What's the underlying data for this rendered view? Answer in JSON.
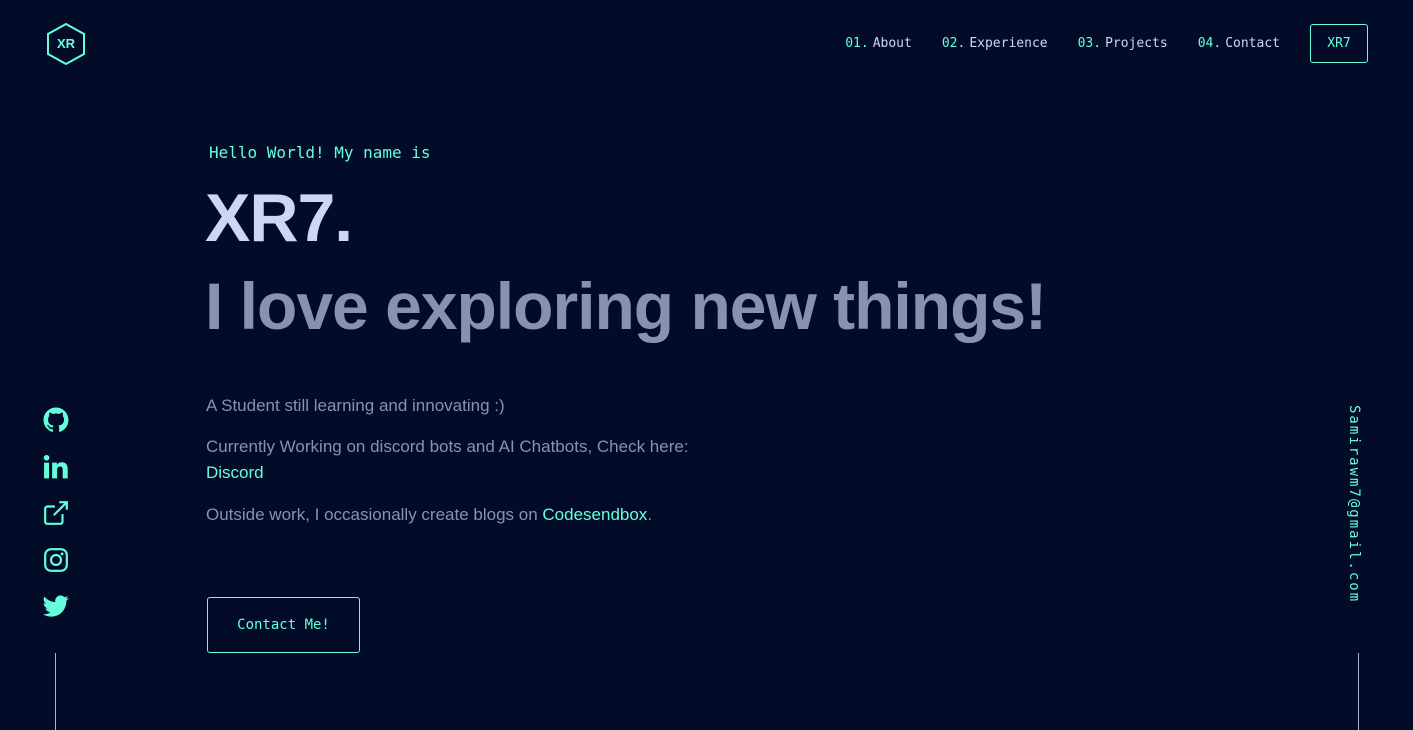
{
  "header": {
    "logo_text": "XR",
    "nav": [
      {
        "num": "01.",
        "label": "About"
      },
      {
        "num": "02.",
        "label": "Experience"
      },
      {
        "num": "03.",
        "label": "Projects"
      },
      {
        "num": "04.",
        "label": "Contact"
      }
    ],
    "resume_label": "XR7"
  },
  "hero": {
    "greeting": "Hello World! My name is",
    "name": "XR7.",
    "tagline": "I love exploring new things!",
    "line1": "A Student still learning and innovating :)",
    "line2": "Currently Working on discord bots and AI Chatbots, Check here:",
    "line2_link": "Discord",
    "line3_prefix": "Outside work, I occasionally create blogs on ",
    "line3_link": "Codesendbox",
    "line3_suffix": ".",
    "cta_label": "Contact Me!"
  },
  "socials": [
    {
      "icon": "github-icon"
    },
    {
      "icon": "linkedin-icon"
    },
    {
      "icon": "external-link-icon"
    },
    {
      "icon": "instagram-icon"
    },
    {
      "icon": "twitter-icon"
    }
  ],
  "email": "Samirawm7@gmail.com",
  "colors": {
    "background": "#020c29",
    "accent": "#64ffda",
    "heading": "#ccd6f6",
    "text": "#8892b0"
  }
}
